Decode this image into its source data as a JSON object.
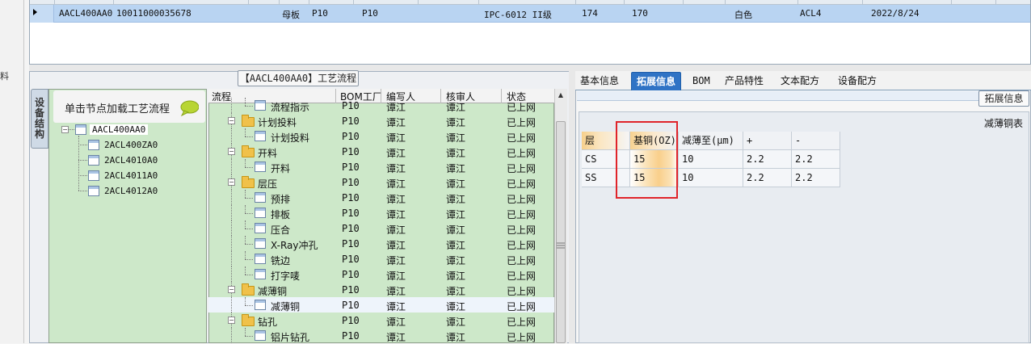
{
  "left_stripe": {
    "fragment": "料"
  },
  "top_grid": {
    "row": {
      "c1": "AACL400AA0",
      "c2": "10011000035678",
      "c3": "母板",
      "c4": "P10",
      "c5": "P10",
      "c6": "IPC-6012 II级",
      "c7": "174",
      "c8": "170",
      "c9": "白色",
      "c10": "ACL4",
      "c11": "2022/8/24"
    }
  },
  "left_panel": {
    "title": "【AACL400AA0】工艺流程",
    "vertical_tab": "设备结构",
    "tree_header": "单击节点加载工艺流程",
    "tree": [
      {
        "label": "AACL400AA0"
      },
      {
        "label": "2ACL400ZA0"
      },
      {
        "label": "2ACL4010A0"
      },
      {
        "label": "2ACL4011A0"
      },
      {
        "label": "2ACL4012A0"
      }
    ],
    "grid_headers": {
      "flow": "流程",
      "bom_plant": "BOM工厂",
      "author": "编写人",
      "reviewer": "核审人",
      "status": "状态"
    },
    "grid_rows": [
      {
        "name": "流程指示",
        "plant": "P10",
        "author": "谭江",
        "reviewer": "谭江",
        "status": "已上网",
        "level": 2
      },
      {
        "name": "计划投料",
        "plant": "P10",
        "author": "谭江",
        "reviewer": "谭江",
        "status": "已上网",
        "level": 1
      },
      {
        "name": "计划投料",
        "plant": "P10",
        "author": "谭江",
        "reviewer": "谭江",
        "status": "已上网",
        "level": 2
      },
      {
        "name": "开料",
        "plant": "P10",
        "author": "谭江",
        "reviewer": "谭江",
        "status": "已上网",
        "level": 1
      },
      {
        "name": "开料",
        "plant": "P10",
        "author": "谭江",
        "reviewer": "谭江",
        "status": "已上网",
        "level": 2
      },
      {
        "name": "层压",
        "plant": "P10",
        "author": "谭江",
        "reviewer": "谭江",
        "status": "已上网",
        "level": 1
      },
      {
        "name": "预排",
        "plant": "P10",
        "author": "谭江",
        "reviewer": "谭江",
        "status": "已上网",
        "level": 2
      },
      {
        "name": "排板",
        "plant": "P10",
        "author": "谭江",
        "reviewer": "谭江",
        "status": "已上网",
        "level": 2
      },
      {
        "name": "压合",
        "plant": "P10",
        "author": "谭江",
        "reviewer": "谭江",
        "status": "已上网",
        "level": 2
      },
      {
        "name": "X-Ray冲孔",
        "plant": "P10",
        "author": "谭江",
        "reviewer": "谭江",
        "status": "已上网",
        "level": 2
      },
      {
        "name": "铣边",
        "plant": "P10",
        "author": "谭江",
        "reviewer": "谭江",
        "status": "已上网",
        "level": 2
      },
      {
        "name": "打字唛",
        "plant": "P10",
        "author": "谭江",
        "reviewer": "谭江",
        "status": "已上网",
        "level": 2
      },
      {
        "name": "减薄铜",
        "plant": "P10",
        "author": "谭江",
        "reviewer": "谭江",
        "status": "已上网",
        "level": 1
      },
      {
        "name": "减薄铜",
        "plant": "P10",
        "author": "谭江",
        "reviewer": "谭江",
        "status": "已上网",
        "level": 2,
        "selected": true
      },
      {
        "name": "钻孔",
        "plant": "P10",
        "author": "谭江",
        "reviewer": "谭江",
        "status": "已上网",
        "level": 1
      },
      {
        "name": "铝片钻孔",
        "plant": "P10",
        "author": "谭江",
        "reviewer": "谭江",
        "status": "已上网",
        "level": 2
      }
    ]
  },
  "right_panel": {
    "tabs": [
      "基本信息",
      "拓展信息",
      "BOM",
      "产品特性",
      "文本配方",
      "设备配方"
    ],
    "active_tab": "拓展信息",
    "ext_button": "拓展信息",
    "table_caption": "减薄铜表",
    "table": {
      "headers": [
        "层",
        "基铜(OZ)",
        "减薄至(μm)",
        "+",
        "-"
      ],
      "rows": [
        [
          "CS",
          "15",
          "10",
          "2.2",
          "2.2"
        ],
        [
          "SS",
          "15",
          "10",
          "2.2",
          "2.2"
        ]
      ]
    }
  },
  "colors": {
    "accent": "#2f73c5",
    "highlight_box": "#e0242a",
    "tree_bg": "#cde8c9",
    "selected_row": "#b9d4f2"
  }
}
